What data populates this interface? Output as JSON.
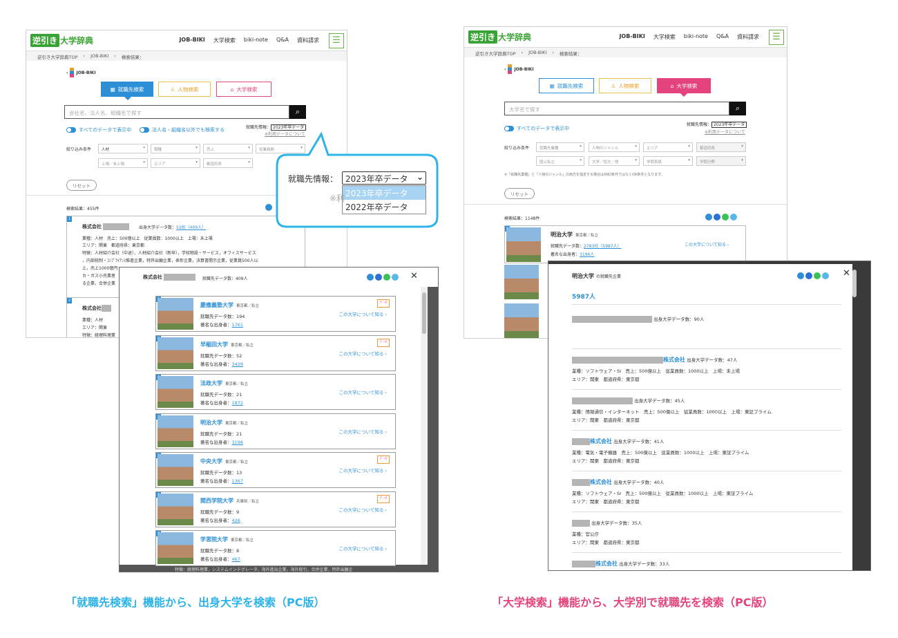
{
  "left": {
    "header": {
      "logo_mark": "逆引き",
      "logo_text": "大学辞典",
      "nav": [
        "JOB-BIKI",
        "大学検索",
        "biki-note",
        "Q&A",
        "資料請求"
      ],
      "menu_icon": "hamburger-icon"
    },
    "breadcrumb": [
      "逆引き大学辞典TOP",
      "JOB-BIKI",
      "検索結果："
    ],
    "brand": "JOB-BIKI",
    "tabs": [
      "就職先検索",
      "人物検索",
      "大学検索"
    ],
    "search_placeholder": "会社名、法人名、組織名で探す",
    "toggle_all": "すべてのデータで表示中",
    "toggle_other": "法人名・組織名以外でも検索する",
    "info_label": "就職先情報：",
    "info_selected": "2023年卒データ",
    "usage_link": "※利用データについて",
    "filter_label": "絞り込み条件",
    "filters_row1": [
      "人材",
      "職種",
      "売上",
      "従業員数"
    ],
    "filters_row2": [
      "上場／未上場",
      "エリア",
      "都道府県"
    ],
    "reset": "リセット",
    "result_count": "検索結果：455件",
    "card1": {
      "num": "1",
      "name": "株式会社",
      "count": "出身大学データ数：",
      "count_link": "52校（409人）",
      "line1": "業種：人材　売上：500億以上　従業員数：1000以上　上場：未上場",
      "line2": "エリア：関東　都道府県：東京都",
      "line3": "特徴：人材紹介会社（中途），人材紹介会社（新卒），学校物設・サービス，オフィスサービス",
      "line4": "，内部統制・ｺﾝﾌﾟﾗｲｱﾝｽ推進企業，特許出願企業，表彰企業，決算書開示企業，従業員500人以",
      "line5": "上，売上1000億円",
      "line6": "カ・ガス小売業者",
      "line7": "る企業，合併企業"
    },
    "card2": {
      "num": "2",
      "name": "株式会社",
      "line1": "業種：人材",
      "line2": "エリア：関東",
      "line3": "特徴：経理料理業"
    },
    "dropdown": {
      "label": "就職先情報：",
      "selected": "2023年卒データ",
      "options": [
        "2023年卒データ",
        "2022年卒データ"
      ],
      "partial": "※利"
    },
    "modal": {
      "title": "株式会社",
      "count": "就職先データ数：409人",
      "close": "✕",
      "more": "この大学について知る ›",
      "badge": "ﾃﾞｰﾀ",
      "rows": [
        {
          "num": "1",
          "name": "慶應義塾大学",
          "loc": "東京都／私立",
          "emp": "就職先データ数：194",
          "alumni_label": "著名な出身者：",
          "alumni": "1761",
          "badge": true
        },
        {
          "num": "2",
          "name": "早稲田大学",
          "loc": "東京都／私立",
          "emp": "就職先データ数：52",
          "alumni_label": "著名な出身者：",
          "alumni": "3429",
          "badge": true
        },
        {
          "num": "3",
          "name": "法政大学",
          "loc": "東京都／私立",
          "emp": "就職先データ数：21",
          "alumni_label": "著名な出身者：",
          "alumni": "1872",
          "badge": false
        },
        {
          "num": "4",
          "name": "明治大学",
          "loc": "東京都／私立",
          "emp": "就職先データ数：21",
          "alumni_label": "著名な出身者：",
          "alumni": "3196",
          "badge": false
        },
        {
          "num": "5",
          "name": "中央大学",
          "loc": "東京都／私立",
          "emp": "就職先データ数：13",
          "alumni_label": "著名な出身者：",
          "alumni": "1367",
          "badge": true
        },
        {
          "num": "6",
          "name": "関西学院大学",
          "loc": "兵庫県／私立",
          "emp": "就職先データ数：9",
          "alumni_label": "著名な出身者：",
          "alumni": "426",
          "badge": true
        },
        {
          "num": "7",
          "name": "学習院大学",
          "loc": "東京都／私立",
          "emp": "就職先データ数：8",
          "alumni_label": "著名な出身者：",
          "alumni": "467",
          "badge": false
        }
      ],
      "bottom_text": "特徴：経理料理業，システムインテグレータ，海外進出企業，海外取引，合併企業，特許出願企"
    },
    "caption": "「就職先検索」機能から、出身大学を検索（PC版）"
  },
  "right": {
    "header": {
      "logo_mark": "逆引き",
      "logo_text": "大学辞典",
      "nav": [
        "JOB-BIKI",
        "大学検索",
        "biki-note",
        "Q&A",
        "資料請求"
      ]
    },
    "breadcrumb": [
      "逆引き大学辞典TOP",
      "JOB-BIKI",
      "検索結果："
    ],
    "brand": "JOB-BIKI",
    "tabs": [
      "就職先検索",
      "人物検索",
      "大学検索"
    ],
    "search_placeholder": "大学名で探す",
    "toggle_all": "すべてのデータで表示中",
    "info_label": "就職先情報：",
    "info_selected": "2023年卒データ",
    "usage_link": "※利用データについて",
    "filter_label": "絞り込み条件",
    "filters_row1": [
      "就職先業種",
      "人物のジャンル",
      "エリア",
      "都道府県"
    ],
    "filters_row2": [
      "国公私立",
      "大学／短大／他",
      "学問系統",
      "学問分野"
    ],
    "note": "※「就職先業種」と「人物のジャンル」の両方を指定する場合はAND条件ではなくOR条件となります。",
    "reset": "リセット",
    "result_count": "検索結果：1148件",
    "card1": {
      "num": "1",
      "name": "明治大学",
      "loc": "東京都／私立",
      "emp_label": "就職先データ数：",
      "emp": "2783社（5987人）",
      "alumni_label": "著名な出身者：",
      "alumni": "3196人",
      "more": "この大学について知る ›"
    },
    "modal": {
      "title": "明治大学",
      "subtitle": "の就職先企業",
      "total": "5987人",
      "close": "✕",
      "rows": [
        {
          "name": "",
          "count": "出身大学データ数：90人",
          "l1": "",
          "l2": ""
        },
        {
          "name": "株式会社",
          "count": "出身大学データ数：47人",
          "l1": "業種：ソフトウェア・SI　売上：500億以上　従業員数：1000以上　上場：未上場",
          "l2": "エリア：関東　都道府県：東京都"
        },
        {
          "name": "",
          "count": "出身大学データ数：45人",
          "l1": "業種：情報通信・インターネット　売上：500億以上　従業員数：1000以上　上場：東証プライム",
          "l2": "エリア：関東　都道府県：東京都"
        },
        {
          "name": "株式会社",
          "count": "出身大学データ数：41人",
          "l1": "業種：電気・電子機器　売上：500億以上　従業員数：1000以上　上場：東証プライム",
          "l2": "エリア：関東　都道府県：東京都"
        },
        {
          "name": "株式会社",
          "count": "出身大学データ数：40人",
          "l1": "業種：ソフトウェア・SI　売上：500億以上　従業員数：1000以上　上場：東証プライム",
          "l2": "エリア：関東　都道府県：東京都"
        },
        {
          "name": "",
          "count": "出身大学データ数：35人",
          "l1": "業種：官公庁",
          "l2": "エリア：関東　都道府県：東京都"
        },
        {
          "name": "株式会社",
          "count": "出身大学データ数：33人",
          "l1": "業種：電気・電子機器　売上：500億以上　従業員数：1000以上　上場：東証プライム",
          "l2": "エリア：関東　都道府県：東京都"
        }
      ]
    },
    "caption": "「大学検索」機能から、大学別で就職先を検索（PC版）"
  },
  "colors": {
    "green": "#3aa335",
    "blue": "#2d8fd5",
    "pink": "#e4447b",
    "orange": "#e8a125",
    "callout": "#2db3e8"
  }
}
